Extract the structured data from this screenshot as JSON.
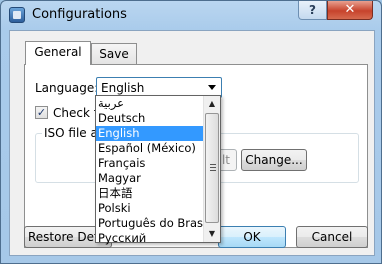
{
  "window": {
    "title": "Configurations",
    "help_label": "?",
    "close_label": "✕"
  },
  "tabs": [
    {
      "label": "General"
    },
    {
      "label": "Save"
    }
  ],
  "general": {
    "language_label": "Language:",
    "language_value": "English",
    "check_label": "Check fo",
    "check_checked": true,
    "iso_group_label": "ISO file as",
    "set_default_label": "default",
    "change_label": "Change..."
  },
  "buttons": {
    "restore": "Restore Defau",
    "ok": "OK",
    "cancel": "Cancel"
  },
  "language_options": [
    "عربية",
    "Deutsch",
    "English",
    "Español (México)",
    "Français",
    "Magyar",
    "日本語",
    "Polski",
    "Português do Brasil",
    "Русский"
  ],
  "selected_option": "English",
  "colors": {
    "selection": "#3399ff",
    "close": "#c7432c"
  }
}
